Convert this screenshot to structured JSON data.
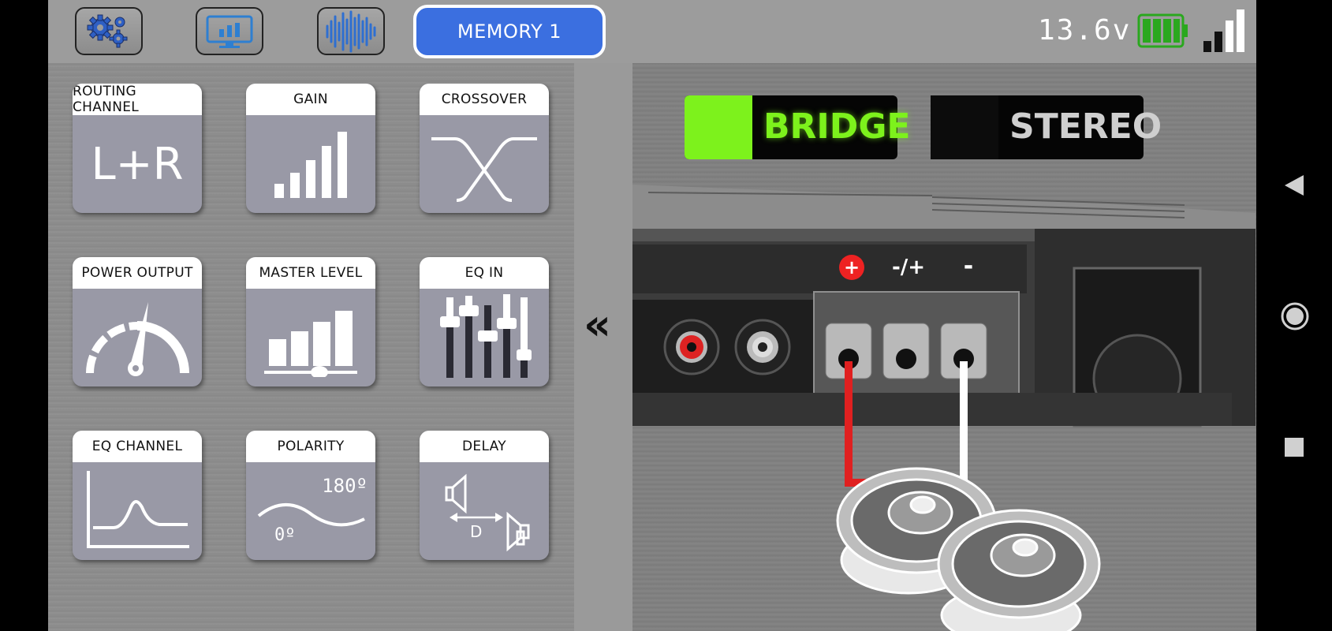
{
  "topbar": {
    "icons": [
      "gear-icon",
      "monitor-chart-icon",
      "waveform-icon"
    ],
    "memory_label": "MEMORY 1",
    "voltage": "13.6v",
    "battery_color": "#2aa81e",
    "accent": "#3b6fe0"
  },
  "tiles": [
    {
      "label": "ROUTING CHANNEL",
      "value": "L+R",
      "icon": "routing-lr-icon"
    },
    {
      "label": "GAIN",
      "icon": "gain-bars-icon"
    },
    {
      "label": "CROSSOVER",
      "icon": "crossover-icon"
    },
    {
      "label": "POWER OUTPUT",
      "icon": "gauge-icon"
    },
    {
      "label": "MASTER LEVEL",
      "icon": "master-level-icon"
    },
    {
      "label": "EQ IN",
      "icon": "equalizer-sliders-icon"
    },
    {
      "label": "EQ CHANNEL",
      "icon": "eq-curve-icon"
    },
    {
      "label": "POLARITY",
      "icon": "phase-wave-icon",
      "phase_high": "180º",
      "phase_low": "0º"
    },
    {
      "label": "DELAY",
      "icon": "delay-speakers-icon",
      "delay_letter": "D"
    }
  ],
  "collapse_glyph": "«",
  "modes": {
    "bridge": {
      "label": "BRIDGE",
      "active": true,
      "color": "#7df21c"
    },
    "stereo": {
      "label": "STEREO",
      "active": false
    }
  },
  "terminals": {
    "plus": "+",
    "mixed": "-/+",
    "minus": "-"
  },
  "nav": [
    "back-icon",
    "home-icon",
    "recents-icon"
  ]
}
